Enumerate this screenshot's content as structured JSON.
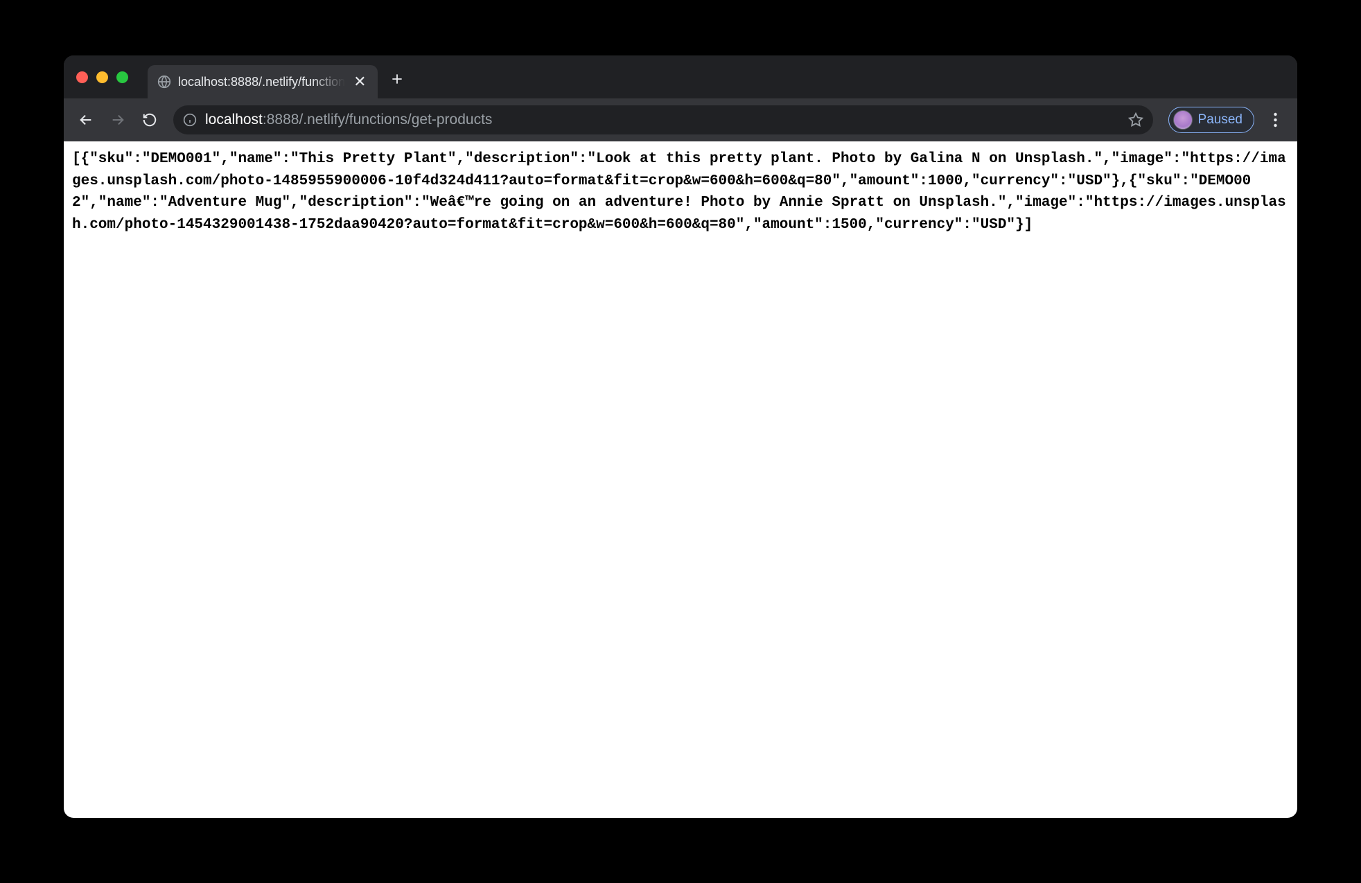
{
  "tab": {
    "title": "localhost:8888/.netlify/function"
  },
  "url": {
    "host": "localhost",
    "rest": ":8888/.netlify/functions/get-products"
  },
  "profile": {
    "label": "Paused"
  },
  "page_body": "[{\"sku\":\"DEMO001\",\"name\":\"This Pretty Plant\",\"description\":\"Look at this pretty plant. Photo by Galina N on Unsplash.\",\"image\":\"https://images.unsplash.com/photo-1485955900006-10f4d324d411?auto=format&fit=crop&w=600&h=600&q=80\",\"amount\":1000,\"currency\":\"USD\"},{\"sku\":\"DEMO002\",\"name\":\"Adventure Mug\",\"description\":\"Weâ€™re going on an adventure! Photo by Annie Spratt on Unsplash.\",\"image\":\"https://images.unsplash.com/photo-1454329001438-1752daa90420?auto=format&fit=crop&w=600&h=600&q=80\",\"amount\":1500,\"currency\":\"USD\"}]"
}
